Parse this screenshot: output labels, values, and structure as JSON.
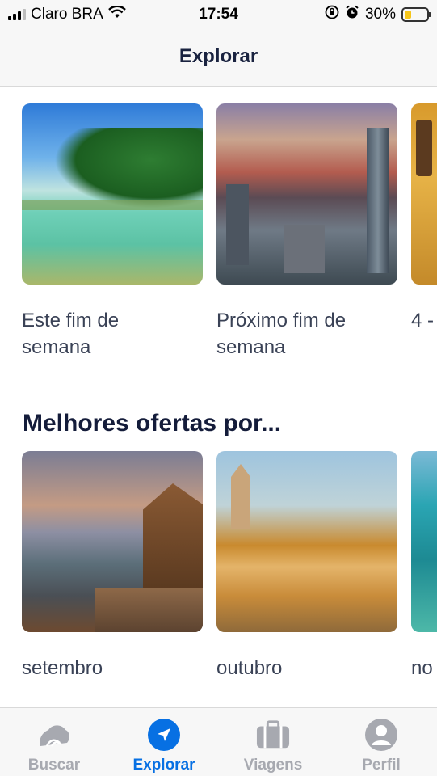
{
  "status_bar": {
    "carrier": "Claro BRA",
    "time": "17:54",
    "battery_percent": "30%",
    "battery_level": 0.3,
    "icons": [
      "signal-icon",
      "wifi-icon",
      "orientation-lock-icon",
      "alarm-icon",
      "battery-icon"
    ]
  },
  "header": {
    "title": "Explorar"
  },
  "weekend_row": {
    "cards": [
      {
        "label": "Este fim de semana",
        "image": "tropical-beach-image"
      },
      {
        "label": "Próximo fim de semana",
        "image": "city-skyline-mountains-image"
      },
      {
        "label": "4 -",
        "image": "colorful-building-image"
      }
    ]
  },
  "offers_section": {
    "title": "Melhores ofertas por...",
    "cards": [
      {
        "label": "setembro",
        "image": "lake-resort-image"
      },
      {
        "label": "outubro",
        "image": "autumn-park-lake-image"
      },
      {
        "label": "no",
        "image": "coastal-sea-image"
      }
    ]
  },
  "tab_bar": {
    "active": "Explorar",
    "active_color": "#0770e3",
    "inactive_color": "#a7a9b0",
    "tabs": [
      {
        "label": "Buscar",
        "icon": "cloud-wave-icon"
      },
      {
        "label": "Explorar",
        "icon": "compass-arrow-icon"
      },
      {
        "label": "Viagens",
        "icon": "suitcase-icon"
      },
      {
        "label": "Perfil",
        "icon": "user-profile-icon"
      }
    ]
  }
}
